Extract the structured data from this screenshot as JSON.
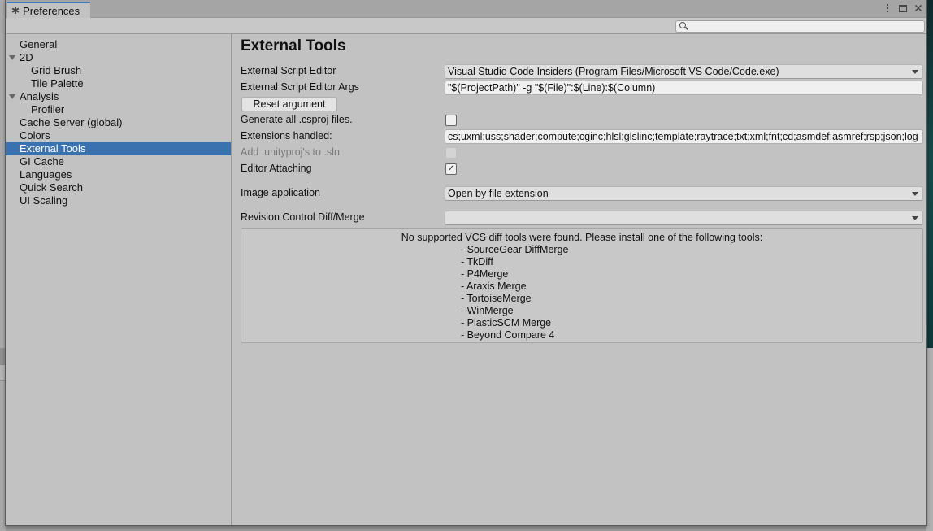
{
  "window": {
    "tab_title": "Preferences",
    "tab_icon": "gear-icon",
    "controls": [
      "more-options-icon",
      "maximize-icon",
      "close-icon"
    ],
    "close_glyph": "✕",
    "gear_glyph": "✱"
  },
  "search": {
    "value": "",
    "placeholder": ""
  },
  "sidebar": {
    "items": [
      {
        "label": "General",
        "level": 0,
        "expandable": false,
        "selected": false
      },
      {
        "label": "2D",
        "level": 0,
        "expandable": true,
        "expanded": true,
        "selected": false
      },
      {
        "label": "Grid Brush",
        "level": 1,
        "selected": false
      },
      {
        "label": "Tile Palette",
        "level": 1,
        "selected": false
      },
      {
        "label": "Analysis",
        "level": 0,
        "expandable": true,
        "expanded": true,
        "selected": false
      },
      {
        "label": "Profiler",
        "level": 1,
        "selected": false
      },
      {
        "label": "Cache Server (global)",
        "level": 0,
        "selected": false
      },
      {
        "label": "Colors",
        "level": 0,
        "selected": false
      },
      {
        "label": "External Tools",
        "level": 0,
        "selected": true
      },
      {
        "label": "GI Cache",
        "level": 0,
        "selected": false
      },
      {
        "label": "Languages",
        "level": 0,
        "selected": false
      },
      {
        "label": "Quick Search",
        "level": 0,
        "selected": false
      },
      {
        "label": "UI Scaling",
        "level": 0,
        "selected": false
      }
    ]
  },
  "main": {
    "title": "External Tools",
    "external_script_editor": {
      "label": "External Script Editor",
      "value": "Visual Studio Code Insiders (Program Files/Microsoft VS Code/Code.exe)"
    },
    "external_script_editor_args": {
      "label": "External Script Editor Args",
      "value": "\"$(ProjectPath)\" -g \"$(File)\":$(Line):$(Column)"
    },
    "reset_argument_button": "Reset argument",
    "generate_csproj": {
      "label": "Generate all .csproj files.",
      "checked": false
    },
    "extensions_handled": {
      "label": "Extensions handled:",
      "value": "cs;uxml;uss;shader;compute;cginc;hlsl;glslinc;template;raytrace;txt;xml;fnt;cd;asmdef;asmref;rsp;json;log"
    },
    "add_unityproj": {
      "label": "Add .unityproj's to .sln",
      "checked": false,
      "disabled": true
    },
    "editor_attaching": {
      "label": "Editor Attaching",
      "checked": true,
      "check_glyph": "✓"
    },
    "image_application": {
      "label": "Image application",
      "value": "Open by file extension"
    },
    "revision_control": {
      "label": "Revision Control Diff/Merge",
      "value": ""
    },
    "vcs_help": {
      "message": "No supported VCS diff tools were found. Please install one of the following tools:",
      "tools": [
        "- SourceGear DiffMerge",
        "- TkDiff",
        "- P4Merge",
        "- Araxis Merge",
        "- TortoiseMerge",
        "- WinMerge",
        "- PlasticSCM Merge",
        "- Beyond Compare 4"
      ]
    }
  },
  "colors": {
    "selection": "#3a72b0",
    "tab_accent": "#3a79c0",
    "panel_bg": "#c2c2c2"
  }
}
